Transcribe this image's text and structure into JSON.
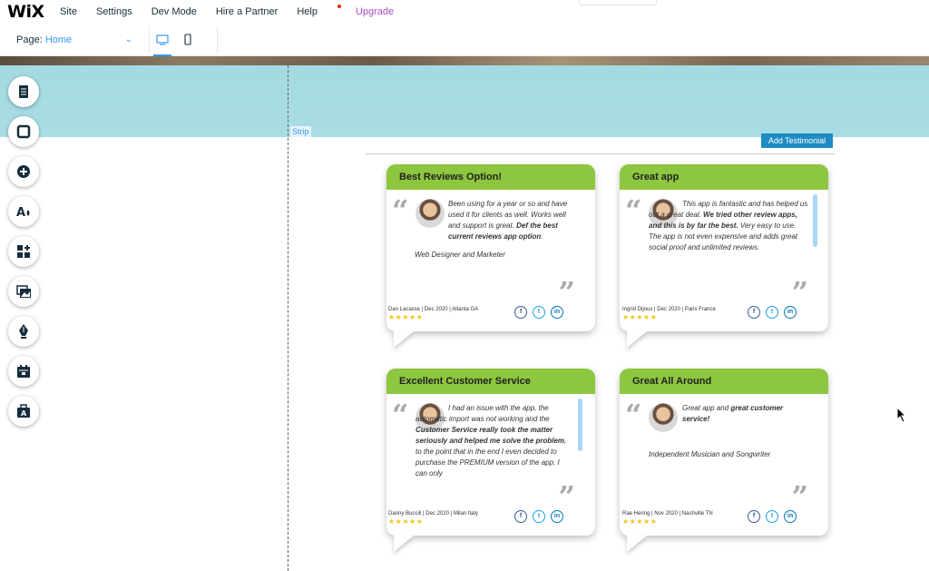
{
  "topbar": {
    "logo": "WiX",
    "menu": [
      "Site",
      "Settings",
      "Dev Mode",
      "Hire a Partner",
      "Help",
      "Upgrade"
    ]
  },
  "subbar": {
    "page_label": "Page:",
    "page_value": "Home"
  },
  "canvas": {
    "strip_label": "Strip",
    "add_button": "Add Testimonial"
  },
  "toolbar_icons": [
    "pages-icon",
    "box-icon",
    "add-icon",
    "design-icon",
    "apps-icon",
    "media-icon",
    "pen-icon",
    "calendar-icon",
    "bag-icon"
  ],
  "cards": [
    {
      "title": "Best Reviews Option!",
      "body_html": "Been using for a year or so and have used it for clients as well. Works well and support is great. <b>Def the best current reviews app option</b>.",
      "role": "Web Designer and Marketer",
      "meta": "Dan Lacasse | Dec 2020 | Atlanta GA",
      "stars": "★★★★★"
    },
    {
      "title": "Great app",
      "body_html": "This app is fantastic and has helped us out a great deal. <b>We tried other review apps, and this is by far the best.</b> Very easy to use. The app is not even expensive and adds great social proof and unlimited reviews.",
      "role": "",
      "meta": "Ingrid Dijoux | Dec 2020 | Paris France",
      "stars": "★★★★★"
    },
    {
      "title": "Excellent Customer Service",
      "body_html": "I had an issue with the app, the automatic import was not working and the <b>Customer Service really took the matter seriously and helped me solve the problem</b>, to the point that in the end I even decided to purchase the PREMIUM version of the app. I can only",
      "role": "",
      "meta": "Danny Buccili | Dec 2020 | Milan Italy",
      "stars": "★★★★★"
    },
    {
      "title": "Great All Around",
      "body_html": "Great app and <b>great customer service!</b>",
      "role": "Independent Musician and Songwriter",
      "meta": "Rae Hering | Nov 2020 | Nashville TN",
      "stars": "★★★★★"
    }
  ]
}
